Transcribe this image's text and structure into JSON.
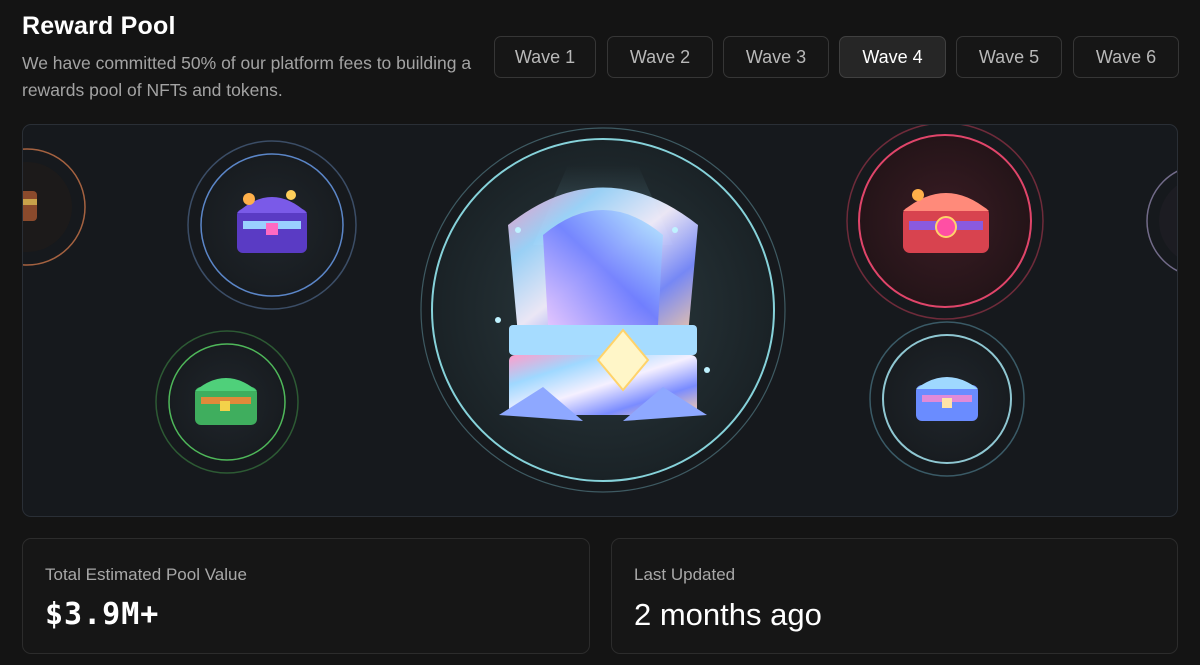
{
  "header": {
    "title": "Reward Pool",
    "subtitle": "We have committed 50% of our platform fees to building a rewards pool of NFTs and tokens."
  },
  "tabs": [
    {
      "label": "Wave 1",
      "active": false
    },
    {
      "label": "Wave 2",
      "active": false
    },
    {
      "label": "Wave 3",
      "active": false
    },
    {
      "label": "Wave 4",
      "active": true
    },
    {
      "label": "Wave 5",
      "active": false
    },
    {
      "label": "Wave 6",
      "active": false
    }
  ],
  "carousel": {
    "items": [
      {
        "name": "chest-orange",
        "ring_color": "#c9744a"
      },
      {
        "name": "chest-purple",
        "ring_color": "#5b86c8"
      },
      {
        "name": "chest-green",
        "ring_color": "#4fb85a"
      },
      {
        "name": "chest-holographic",
        "ring_color": "#86d2da"
      },
      {
        "name": "chest-red",
        "ring_color": "#e0456a"
      },
      {
        "name": "chest-blue",
        "ring_color": "#8fc7d2"
      },
      {
        "name": "chest-lavender",
        "ring_color": "#9a8fb8"
      },
      {
        "name": "chest-pink",
        "ring_color": "#d878a8"
      }
    ]
  },
  "stats": {
    "pool_value_label": "Total Estimated Pool Value",
    "pool_value": "$3.9M+",
    "last_updated_label": "Last Updated",
    "last_updated": "2 months ago"
  }
}
